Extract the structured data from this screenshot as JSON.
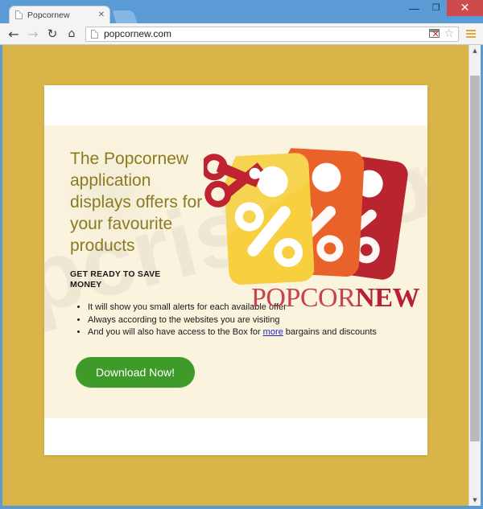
{
  "window": {
    "minimize_label": "—",
    "maximize_label": "❐",
    "close_label": "✕"
  },
  "tab": {
    "title": "Popcornew",
    "close_label": "✕"
  },
  "toolbar": {
    "back_label": "←",
    "forward_label": "→",
    "reload_label": "↻",
    "home_label": "⌂",
    "url": "popcornew.com",
    "popup_blocked_x": "✕",
    "bookmark_label": "☆"
  },
  "scrollbar": {
    "up_label": "▲",
    "down_label": "▼"
  },
  "page": {
    "watermark_text": "pcrisk.com",
    "headline": "The Popcornew application displays offers for your favourite products",
    "subhead": "GET READY TO SAVE MONEY",
    "bullets": [
      "It will show you small alerts for each available offer",
      "Always according to the websites you are visiting"
    ],
    "bullet3_prefix": "And you will also have access to the Box for ",
    "bullet3_link": "more",
    "bullet3_suffix": " bargains and discounts",
    "cta_label": "Download Now!",
    "brand_part1": "POPCOR",
    "brand_part2": "NEW",
    "percent_symbol": "%"
  },
  "colors": {
    "page_background": "#d9b449",
    "hero_background": "#faf3dd",
    "headline": "#8a7a22",
    "cta_green": "#3f9b29",
    "brand_light_red": "#c6444f",
    "brand_dark_red": "#b81f31",
    "tag_yellow": "#f7cf3f",
    "tag_orange": "#e8622a",
    "tag_darkred": "#b8252f",
    "scissors_red": "#bf2230",
    "link_blue": "#2222cc",
    "browser_blue": "#5b9bd5",
    "close_button_red": "#cf4b4b"
  }
}
